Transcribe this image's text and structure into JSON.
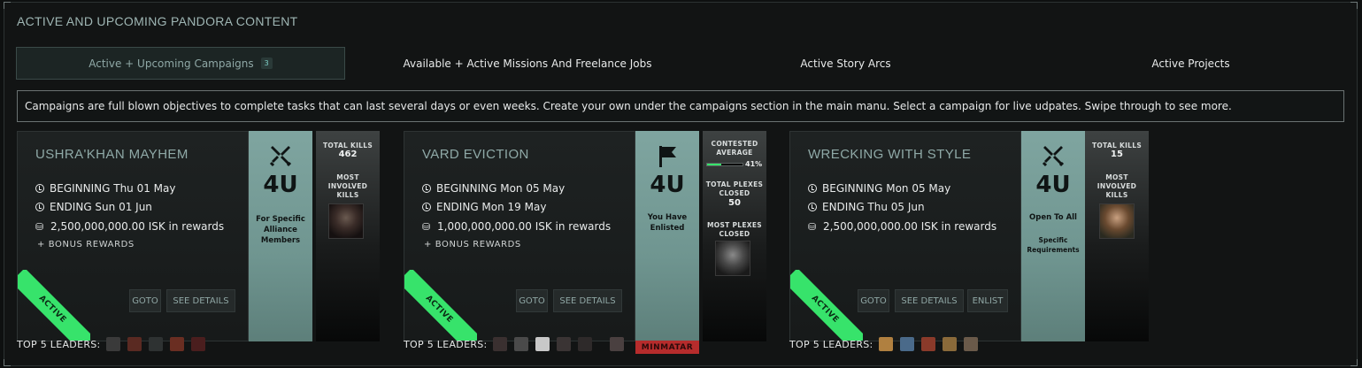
{
  "section_title": "ACTIVE AND UPCOMING PANDORA CONTENT",
  "tabs": [
    {
      "label": "Active + Upcoming Campaigns",
      "badge": "3"
    },
    {
      "label": "Available + Active Missions And Freelance Jobs"
    },
    {
      "label": "Active Story Arcs"
    },
    {
      "label": "Active Projects"
    }
  ],
  "info_text": "Campaigns are full blown objectives to complete tasks that can last several days or even weeks. Create your own under the campaigns section in the main manu. Select a campaign for live udpates. Swipe through to see more.",
  "campaigns": [
    {
      "title": "USHRA'KHAN MAYHEM",
      "beginning": "BEGINNING Thu 01 May",
      "ending": "ENDING Sun 01 Jun",
      "rewards": "2,500,000,000.00 ISK in rewards",
      "bonus": "+ BONUS REWARDS",
      "status": "ACTIVE",
      "size": "4U",
      "requirement": "For Specific Alliance Members",
      "stat1_label": "TOTAL KILLS",
      "stat1_value": "462",
      "stat2_label": "MOST INVOLVED KILLS",
      "buttons": [
        "GOTO",
        "SEE DETAILS"
      ],
      "leaders_label": "TOP 5 LEADERS:"
    },
    {
      "title": "VARD EVICTION",
      "beginning": "BEGINNING Mon 05 May",
      "ending": "ENDING Mon 19 May",
      "rewards": "1,000,000,000.00 ISK in rewards",
      "bonus": "+ BONUS REWARDS",
      "status": "ACTIVE",
      "size": "4U",
      "requirement": "You Have Enlisted",
      "stat1_label": "CONTESTED AVERAGE",
      "progress": 0.41,
      "progress_label": "41%",
      "stat2_label": "TOTAL PLEXES CLOSED",
      "stat2_value": "50",
      "stat3_label": "MOST PLEXES CLOSED",
      "buttons": [
        "GOTO",
        "SEE DETAILS"
      ],
      "leaders_label": "TOP 5 LEADERS:",
      "faction": "MINMATAR"
    },
    {
      "title": "WRECKING WITH STYLE",
      "beginning": "BEGINNING Mon 05 May",
      "ending": "ENDING Thu 05 Jun",
      "rewards": "2,500,000,000.00 ISK in rewards",
      "status": "ACTIVE",
      "size": "4U",
      "requirement": "Open To All",
      "requirement2": "Specific Requirements",
      "stat1_label": "TOTAL KILLS",
      "stat1_value": "15",
      "stat2_label": "MOST INVOLVED KILLS",
      "buttons": [
        "GOTO",
        "SEE DETAILS",
        "ENLIST"
      ],
      "leaders_label": "TOP 5 LEADERS:"
    }
  ],
  "colors": {
    "accent": "#37e36b",
    "teal": "#7fa5a0",
    "faction": "#b62c2c"
  }
}
